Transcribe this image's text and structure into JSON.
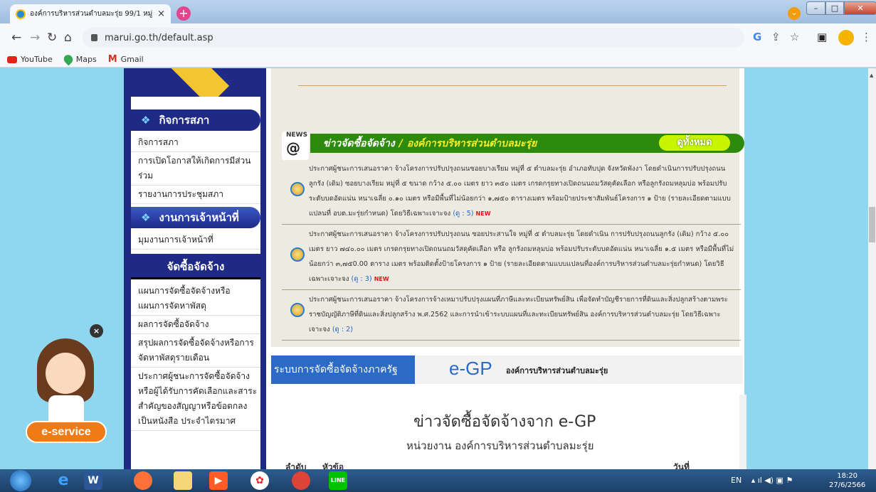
{
  "browser": {
    "tab_title": "องค์การบริหารส่วนตำบลมะรุ่ย 99/1 หมู่",
    "tab_close": "×",
    "new_tab": "+",
    "url": "marui.go.th/default.asp",
    "bookmarks": [
      {
        "label": "YouTube"
      },
      {
        "label": "Maps"
      },
      {
        "label": "Gmail"
      }
    ]
  },
  "sidebar": {
    "section1_title": "กิจการสภา",
    "section1_items": [
      "กิจการสภา",
      "การเปิดโอกาสให้เกิดการมีส่วนร่วม",
      "รายงานการประชุมสภา"
    ],
    "section2_title": "งานการเจ้าหน้าที่",
    "section2_items": [
      "มุมงานการเจ้าหน้าที่"
    ],
    "section3_title": "จัดซื้อจัดจ้าง",
    "section3_items": [
      "แผนการจัดซื้อจัดจ้างหรือแผนการจัดหาพัสดุ",
      "ผลการจัดซื้อจัดจ้าง",
      "สรุปผลการจัดซื้อจัดจ้างหรือการจัดหาพัสดุรายเดือน",
      "ประกาศผู้ชนะการจัดซื้อจัดจ้างหรือผู้ได้รับการคัดเลือกและสาระสำคัญของสัญญาหรือข้อตกลงเป็นหนังสือ ประจำไตรมาศ"
    ]
  },
  "news": {
    "icon_label": "NEWS",
    "icon_symbol": "@",
    "title": "ข่าวจัดซื้อจัดจ้าง",
    "separator": "/",
    "org": "องค์การบริหารส่วนตำบลมะรุ่ย",
    "view_all": "ดูทั้งหมด",
    "items": [
      {
        "text": "ประกาศผู้ชนะการเสนอราคา จ้างโครงการปรับปรุงถนนซอยบางเรียม หมู่ที่ ๕ ตำบลมะรุ่ย อำเภอทับปุด จังหวัดพังงา โดยดำเนินการปรับปรุงถนนลูกรัง (เดิม) ซอยบางเรียม หมู่ที่ ๕ ขนาด กว้าง ๕.๐๐ เมตร ยาว ๓๕๐ เมตร เกรดกรุยทางเปิดถนนถมวัสดุคัดเลือก หรือลูกรังถมหลุมบ่อ พร้อมปรับระดับบดอัดแน่น หนาเฉลี่ย ๐.๑๐ เมตร หรือมีพื้นที่ไม่น้อยกว่า ๑,๗๕๐ ตารางเมตร พร้อมป้ายประชาสัมพันธ์โครงการ ๑ ป้าย (รายละเอียดตามแบบแปลนที่ อบต.มะรุ่ยกำหนด) โดยวิธีเฉพาะเจาะจง",
        "views": "(ดู : 5)",
        "new": "NEW"
      },
      {
        "text": "ประกาศผู้ชนะการเสนอราคา จ้างโครงการปรับปรุงถนน ซอยประสานใจ หมู่ที่ ๕ ตำบลมะรุ่ย โดยดำเนิน การปรับปรุงถนนลูกรัง (เดิม) กว้าง ๕.๐๐ เมตร ยาว ๗๔๐.๐๐ เมตร เกรดกรุยทางเปิดถนนถมวัสดุคัดเลือก หรือ ลูกรังถมหลุมบ่อ พร้อมปรับระดับบดอัดแน่น หนาเฉลี่ย ๑.๕ เมตร หรือมีพื้นที่ไม่น้อยกว่า ๓,๗๕0.00 ตาราง เมตร พร้อมติดตั้งป้ายโครงการ ๑ ป้าย (รายละเอียดตามแบบแปลนที่องค์การบริหารส่วนตำบลมะรุ่ยกำหนด) โดยวิธีเฉพาะเจาะจง",
        "views": "(ดู : 3)",
        "new": "NEW"
      },
      {
        "text": "ประกาศผู้ชนะการเสนอราคา จ้างโครงการจ้างเหมาปรับปรุงแผนที่ภาษีและทะเบียนทรัพย์สิน เพื่อจัดทำบัญชีรายการที่ดินและสิ่งปลูกสร้างตามพระราชบัญญัติภาษีที่ดินและสิ่งปลูกสร้าง พ.ศ.2562 และการนำเข้าระบบแผนที่และทะเบียนทรัพย์สิน องค์การบริหารส่วนตำบลมะรุ่ย โดยวิธีเฉพาะเจาะจง",
        "views": "(ดู : 2)",
        "new": ""
      }
    ]
  },
  "egp": {
    "tag": "ระบบการจัดซื้อจัดจ้างภาครัฐ",
    "logo": "e-GP",
    "org": "องค์การบริหารส่วนตำบลมะรุ่ย",
    "title": "ข่าวจัดซื้อจัดจ้างจาก e-GP",
    "subtitle": "หน่วยงาน องค์การบริหารส่วนตำบลมะรุ่ย",
    "col1": "ลำดับ",
    "col2": "หัวข้อ",
    "col3": "วันที่"
  },
  "widget": {
    "close": "×",
    "eservice": "e-service"
  },
  "taskbar": {
    "lang": "EN",
    "time": "18:20",
    "date": "27/6/2566"
  },
  "colors": {
    "page_bg": "#8fd7ef",
    "navy": "#1e2a86",
    "news_green": "#2e8a0d",
    "egp_blue": "#2b6ac5"
  }
}
